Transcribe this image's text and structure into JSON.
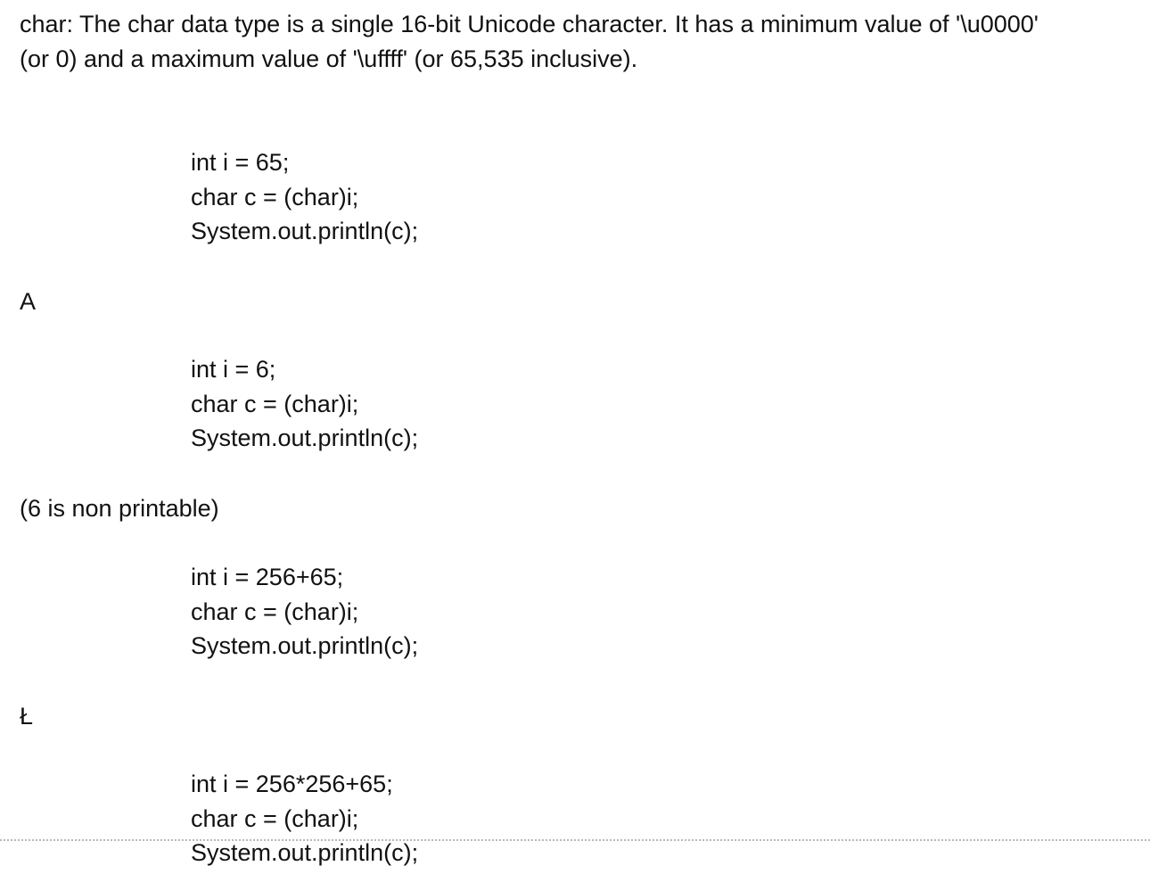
{
  "intro": {
    "line1": "char: The char data type is a single 16-bit Unicode character. It has a minimum value of '\\u0000'",
    "line2": "(or 0) and a maximum value of '\\uffff' (or 65,535 inclusive)."
  },
  "examples": [
    {
      "code": [
        "int i = 65;",
        "char c = (char)i;",
        "System.out.println(c);"
      ],
      "output": "A"
    },
    {
      "code": [
        "int i = 6;",
        "char c = (char)i;",
        "System.out.println(c);"
      ],
      "output": "(6 is non printable)"
    },
    {
      "code": [
        "int i = 256+65;",
        "char c = (char)i;",
        "System.out.println(c);"
      ],
      "output": "Ł"
    },
    {
      "code": [
        "int i = 256*256+65;",
        "char c = (char)i;",
        "System.out.println(c);"
      ]
    }
  ]
}
